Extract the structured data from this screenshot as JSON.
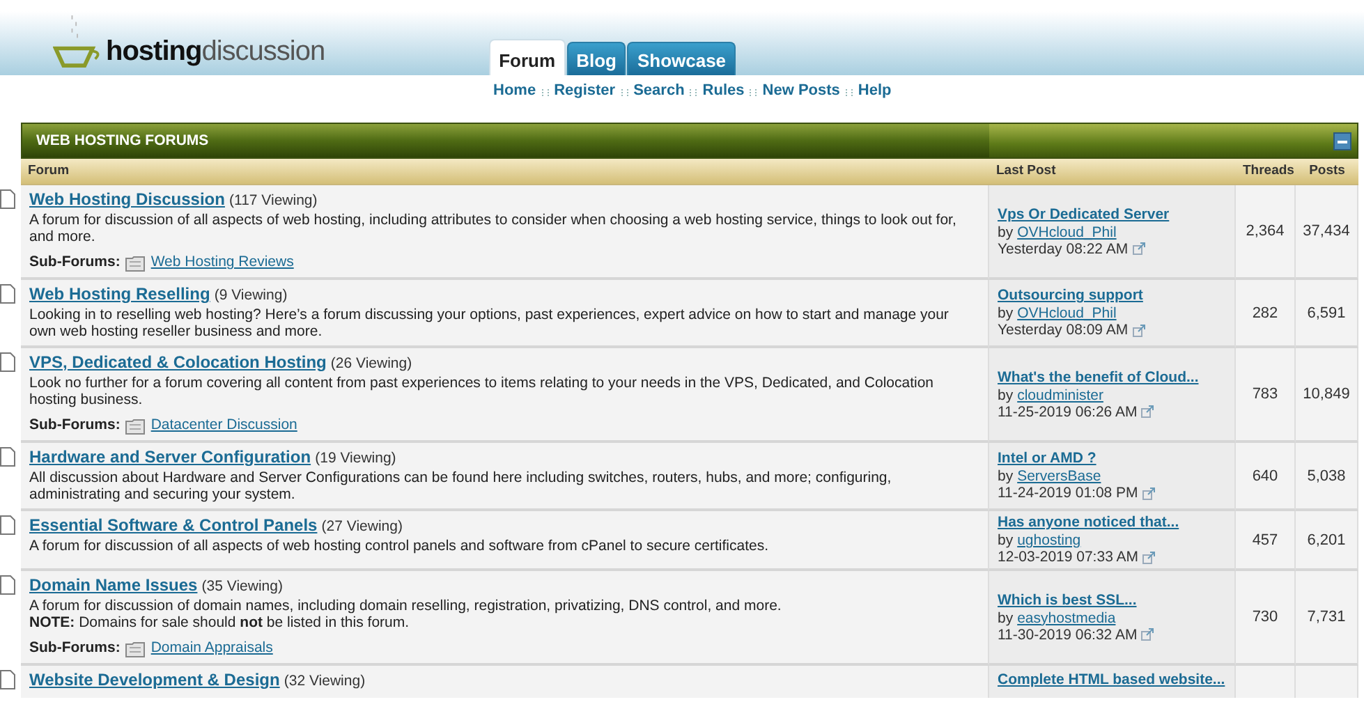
{
  "logo": {
    "text": "**hosting**discussion"
  },
  "tabs": [
    {
      "label": "Forum",
      "selected": true
    },
    {
      "label": "Blog",
      "selected": false
    },
    {
      "label": "Showcase",
      "selected": false
    }
  ],
  "nav": [
    "Home",
    "Register",
    "Search",
    "Rules",
    "New Posts",
    "Help"
  ],
  "forum_table": {
    "title": "WEB HOSTING FORUMS",
    "columns": [
      "Forum",
      "Last Post",
      "Threads",
      "Posts"
    ],
    "rows": [
      {
        "title": "Web Hosting Discussion",
        "viewing": "(117 Viewing)",
        "description": "A forum for discussion of all aspects of web hosting, including attributes to consider when choosing a web hosting service, things to look out for, and more.",
        "sub_forums_label": "Sub-Forums:",
        "sub_forums": [
          "Web Hosting Reviews"
        ],
        "last_post": {
          "title": "Vps Or Dedicated Server",
          "by": "by",
          "user": "OVHcloud_Phil",
          "date": "Yesterday 08:22 AM"
        },
        "threads": "2,364",
        "posts": "37,434"
      },
      {
        "title": "Web Hosting Reselling",
        "viewing": "(9 Viewing)",
        "description": "Looking in to reselling web hosting? Here’s a forum discussing your options, past experiences, expert advice on how to start and manage your own web hosting reseller business and more.",
        "last_post": {
          "title": "Outsourcing support",
          "by": "by",
          "user": "OVHcloud_Phil",
          "date": "Yesterday 08:09 AM"
        },
        "threads": "282",
        "posts": "6,591"
      },
      {
        "title": "VPS, Dedicated & Colocation Hosting",
        "viewing": "(26 Viewing)",
        "description": "Look no further for a forum covering all content from past experiences to items relating to your needs in the VPS, Dedicated, and Colocation hosting business.",
        "sub_forums_label": "Sub-Forums:",
        "sub_forums": [
          "Datacenter Discussion"
        ],
        "last_post": {
          "title": "What's the benefit of Cloud...",
          "by": "by",
          "user": "cloudminister",
          "date": "11-25-2019 06:26 AM"
        },
        "threads": "783",
        "posts": "10,849"
      },
      {
        "title": "Hardware and Server Configuration",
        "viewing": "(19 Viewing)",
        "description": "All discussion about Hardware and Server Configurations can be found here including switches, routers, hubs, and more; configuring, administrating and securing your system.",
        "last_post": {
          "title": "Intel or AMD ?",
          "by": "by",
          "user": "ServersBase",
          "date": "11-24-2019 01:08 PM"
        },
        "threads": "640",
        "posts": "5,038"
      },
      {
        "title": "Essential Software & Control Panels",
        "viewing": "(27 Viewing)",
        "description": "A forum for discussion of all aspects of web hosting control panels and software from cPanel to secure certificates.",
        "last_post": {
          "title": "Has anyone noticed that...",
          "by": "by",
          "user": "ughosting",
          "date": "12-03-2019 07:33 AM"
        },
        "threads": "457",
        "posts": "6,201"
      },
      {
        "title": "Domain Name Issues",
        "viewing": "(35 Viewing)",
        "description": "A forum for discussion of domain names, including domain reselling, registration, privatizing, DNS control, and more.",
        "note": "**NOTE:** Domains for sale should **not** be listed in this forum.",
        "sub_forums_label": "Sub-Forums:",
        "sub_forums": [
          "Domain Appraisals"
        ],
        "last_post": {
          "title": "Which is best SSL...",
          "by": "by",
          "user": "easyhostmedia",
          "date": "11-30-2019 06:32 AM"
        },
        "threads": "730",
        "posts": "7,731"
      },
      {
        "title": "Website Development & Design",
        "viewing": "(32 Viewing)",
        "last_post": {
          "title": "Complete HTML based website..."
        }
      }
    ]
  }
}
